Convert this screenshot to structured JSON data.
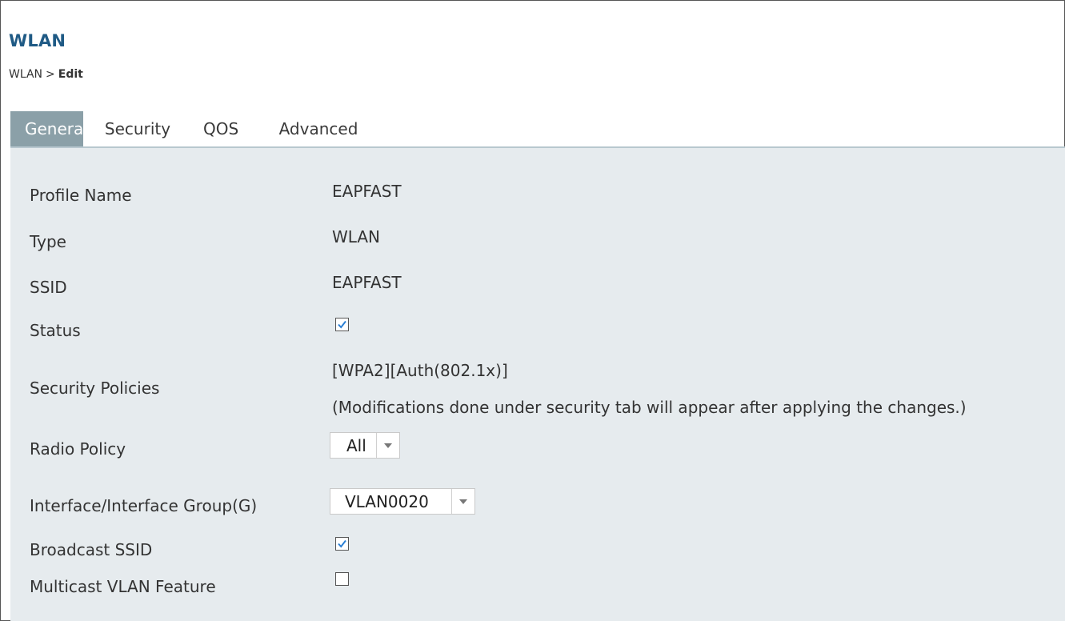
{
  "header": {
    "title": "WLAN",
    "breadcrumb": {
      "parent": "WLAN",
      "separator": ">",
      "current": "Edit"
    }
  },
  "tabs": [
    {
      "label": "General",
      "active": true
    },
    {
      "label": "Security",
      "active": false
    },
    {
      "label": "QOS",
      "active": false
    },
    {
      "label": "Advanced",
      "active": false
    }
  ],
  "form": {
    "profile_name": {
      "label": "Profile Name",
      "value": "EAPFAST"
    },
    "type": {
      "label": "Type",
      "value": "WLAN"
    },
    "ssid": {
      "label": "SSID",
      "value": "EAPFAST"
    },
    "status": {
      "label": "Status",
      "checked": true
    },
    "security_policies": {
      "label": "Security Policies",
      "value": "[WPA2][Auth(802.1x)]",
      "note": "(Modifications done under security tab will appear after applying the changes.)"
    },
    "radio_policy": {
      "label": "Radio Policy",
      "selected": "All"
    },
    "interface": {
      "label": "Interface/Interface Group(G)",
      "selected": "VLAN0020"
    },
    "broadcast_ssid": {
      "label": "Broadcast SSID",
      "checked": true
    },
    "multicast_vlan": {
      "label": "Multicast VLAN Feature",
      "checked": false
    }
  },
  "colors": {
    "title": "#1f5a85",
    "active_tab": "#8ba0a8",
    "panel": "#e6ebee",
    "checkmark": "#2a7fd4"
  }
}
